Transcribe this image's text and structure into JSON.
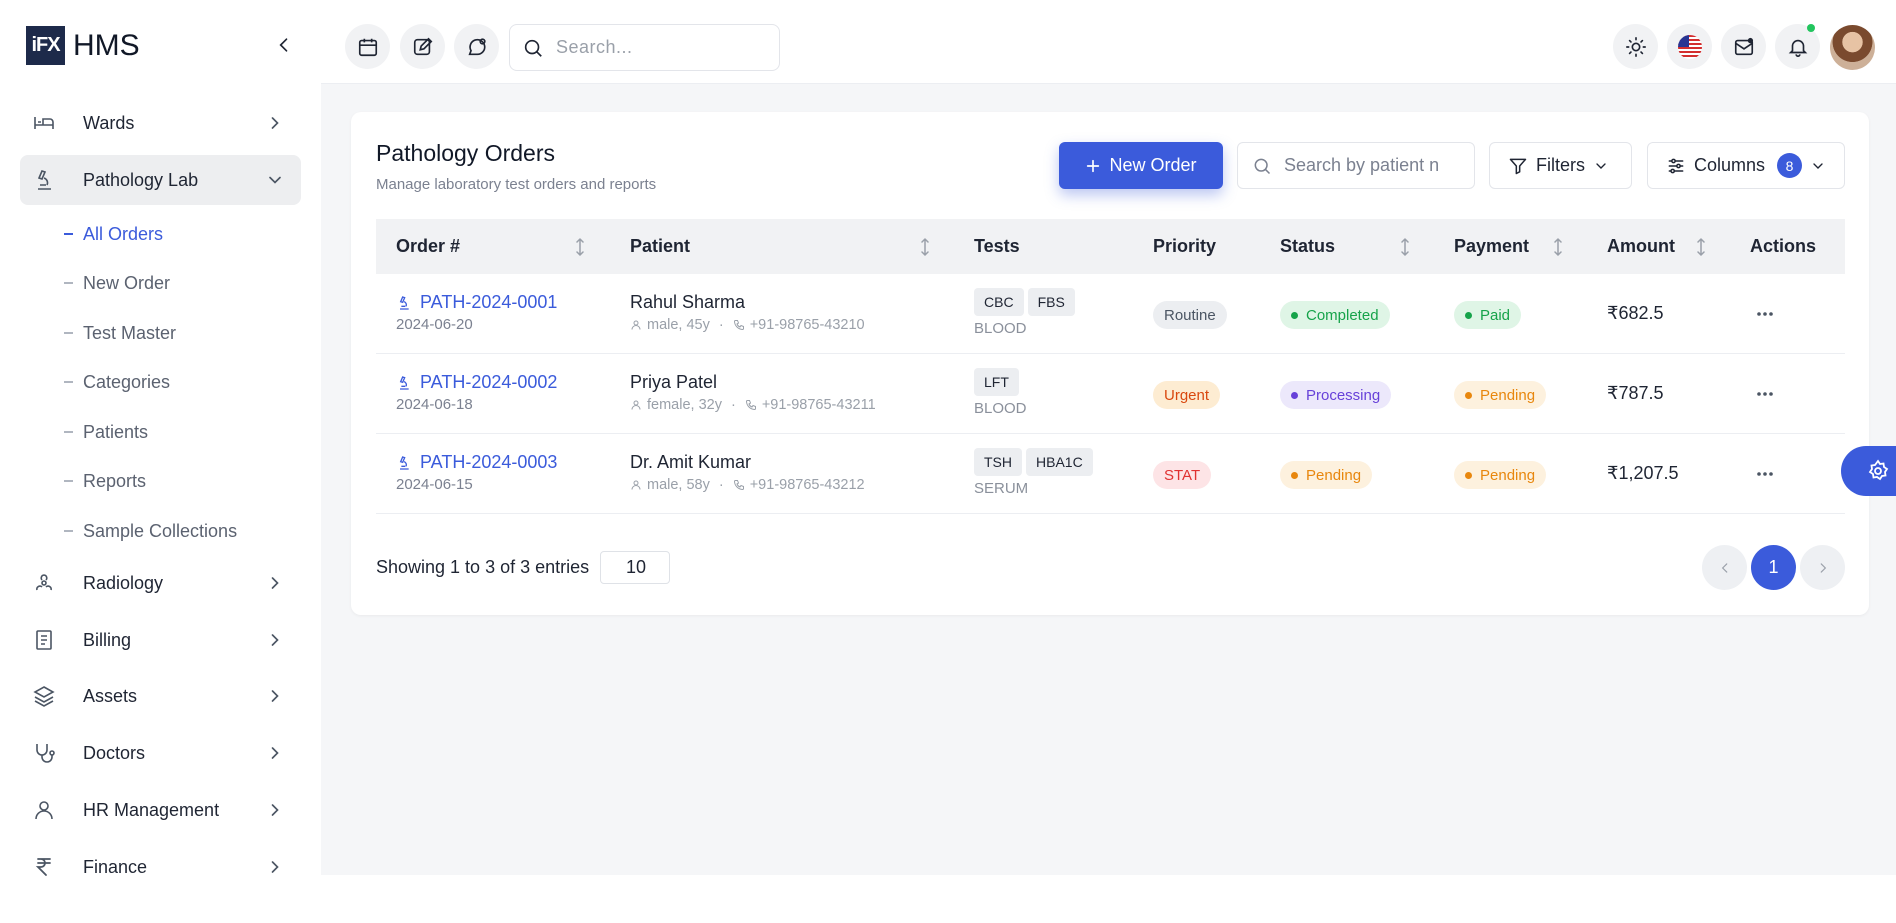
{
  "brand": {
    "logo_text": "iFX",
    "name": "HMS"
  },
  "sidebar": {
    "items": [
      {
        "label": "Wards",
        "icon": "bed-icon"
      },
      {
        "label": "Pathology Lab",
        "icon": "microscope-icon",
        "active": true
      },
      {
        "label": "Radiology",
        "icon": "radiology-icon"
      },
      {
        "label": "Billing",
        "icon": "receipt-icon"
      },
      {
        "label": "Assets",
        "icon": "layers-icon"
      },
      {
        "label": "Doctors",
        "icon": "stethoscope-icon"
      },
      {
        "label": "HR Management",
        "icon": "user-icon"
      },
      {
        "label": "Finance",
        "icon": "rupee-icon"
      }
    ],
    "sub_items": [
      {
        "label": "All Orders",
        "active": true
      },
      {
        "label": "New Order"
      },
      {
        "label": "Test Master"
      },
      {
        "label": "Categories"
      },
      {
        "label": "Patients"
      },
      {
        "label": "Reports"
      },
      {
        "label": "Sample Collections"
      }
    ]
  },
  "topbar": {
    "search_placeholder": "Search..."
  },
  "page": {
    "title": "Pathology Orders",
    "subtitle": "Manage laboratory test orders and reports",
    "new_order_label": "New Order",
    "search_placeholder": "Search by patient n",
    "filters_label": "Filters",
    "columns_label": "Columns",
    "columns_count": "8"
  },
  "table": {
    "headers": [
      "Order #",
      "Patient",
      "Tests",
      "Priority",
      "Status",
      "Payment",
      "Amount",
      "Actions"
    ],
    "rows": [
      {
        "order": "PATH-2024-0001",
        "date": "2024-06-20",
        "patient": "Rahul Sharma",
        "demo": "male, 45y",
        "phone": "+91-98765-43210",
        "tests": [
          "CBC",
          "FBS"
        ],
        "sample": "BLOOD",
        "priority": "Routine",
        "status": "Completed",
        "payment": "Paid",
        "amount": "₹682.5"
      },
      {
        "order": "PATH-2024-0002",
        "date": "2024-06-18",
        "patient": "Priya Patel",
        "demo": "female, 32y",
        "phone": "+91-98765-43211",
        "tests": [
          "LFT"
        ],
        "sample": "BLOOD",
        "priority": "Urgent",
        "status": "Processing",
        "payment": "Pending",
        "amount": "₹787.5"
      },
      {
        "order": "PATH-2024-0003",
        "date": "2024-06-15",
        "patient": "Dr. Amit Kumar",
        "demo": "male, 58y",
        "phone": "+91-98765-43212",
        "tests": [
          "TSH",
          "HBA1C"
        ],
        "sample": "SERUM",
        "priority": "STAT",
        "status": "Pending",
        "payment": "Pending",
        "amount": "₹1,207.5"
      }
    ]
  },
  "footer": {
    "showing": "Showing 1 to 3 of 3 entries",
    "page_size": "10",
    "current_page": "1"
  },
  "colors": {
    "accent": "#3b5bdb",
    "routine_bg": "#eceef1",
    "routine_fg": "#4b5563",
    "urgent_bg": "#fdecd2",
    "urgent_fg": "#d9480f",
    "stat_bg": "#fde4e6",
    "stat_fg": "#e03131",
    "completed_bg": "#dff5e6",
    "completed_fg": "#16a34a",
    "processing_bg": "#ece8fb",
    "processing_fg": "#6741d9",
    "pending_bg": "#fdf1de",
    "pending_fg": "#e8870e",
    "paid_bg": "#dff5e6",
    "paid_fg": "#16a34a"
  }
}
